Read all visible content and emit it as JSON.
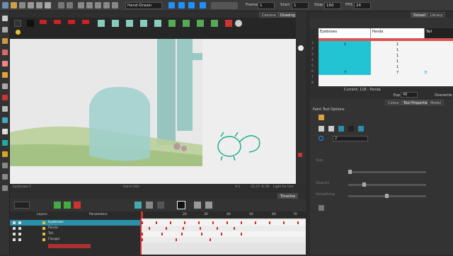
{
  "toolbar": {
    "mode": "Hand-Drawn",
    "frame_label": "Frame",
    "frame_value": "1",
    "start_label": "Start",
    "start_value": "1",
    "stop_label": "Stop",
    "stop_value": "160",
    "fps_label": "FPS",
    "fps_value": "24"
  },
  "view_tabs": {
    "camera": "Camera",
    "drawing": "Drawing"
  },
  "status_bar": {
    "drawing_name": "Eyebrows-1",
    "tool_hint": "Hand (Alt)",
    "zoom": "X:1",
    "coordinates": "32.27 -6.78",
    "lighting": "Light for line"
  },
  "timeline": {
    "tab": "Timeline",
    "layers_header": "Layers",
    "params_header": "Parameters",
    "layers": [
      {
        "name": "Eyebrows"
      },
      {
        "name": "Panda"
      },
      {
        "name": "Tail"
      },
      {
        "name": "Flanger"
      }
    ],
    "ruler_marks": [
      "1",
      "20",
      "30",
      "40",
      "50",
      "60",
      "70"
    ]
  },
  "xsheet": {
    "tab": "Xsheet",
    "library_tab": "Library",
    "columns": [
      "Eyebrows",
      "Panda",
      "Tail"
    ],
    "row_numbers": [
      "1",
      "2",
      "3",
      "4",
      "5",
      "6",
      "7",
      "8"
    ],
    "eyebrows_values": [
      "1",
      "",
      "",
      "",
      "",
      "",
      "7",
      ""
    ],
    "panda_values": [
      "1",
      "1",
      "1",
      "1",
      "1",
      "1",
      "7",
      ""
    ],
    "tail_values": [
      "",
      "",
      "",
      "",
      "",
      "",
      "B",
      ""
    ],
    "current_label": "Current: 118 : Panda",
    "exp_label": "Exp",
    "exp_value": "48",
    "overwrite_label": "Overwrite"
  },
  "properties": {
    "colour_tab": "Colour",
    "tool_props_tab": "Tool Properties",
    "model_tab": "Model",
    "section_title": "Paint Tool Options",
    "field_value": "2",
    "sliders": [
      {
        "label": "Size",
        "value": 0.05
      },
      {
        "label": "Opacity",
        "value": 0.15
      },
      {
        "label": "Smoothing",
        "value": 0.5
      }
    ]
  },
  "colors": {
    "accent_blue": "#1e90ff",
    "cyan_cells": "#22c4d4",
    "highlight_red": "#d42a2a",
    "stage_bg": "#eeeeee"
  }
}
